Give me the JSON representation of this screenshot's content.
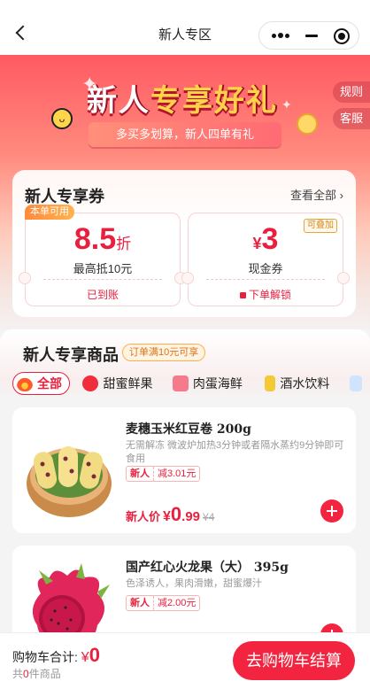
{
  "nav": {
    "title": "新人专区"
  },
  "banner": {
    "title_a": "新人",
    "title_b": "专享好礼",
    "subtitle": "多买多划算，新人四单有礼",
    "rules": "规则",
    "service": "客服"
  },
  "coupons": {
    "heading": "新人专享券",
    "view_all": "查看全部 ›",
    "items": [
      {
        "tag": "本单可用",
        "value": "8.5",
        "unit": "折",
        "desc": "最高抵10元",
        "status": "已到账"
      },
      {
        "tag": "可叠加",
        "currency": "¥",
        "value": "3",
        "desc": "现金券",
        "status": "下单解锁"
      }
    ]
  },
  "goods": {
    "heading": "新人专享商品",
    "tip": "订单满10元可享",
    "categories": [
      "全部",
      "甜蜜鲜果",
      "肉蛋海鲜",
      "酒水饮料"
    ],
    "products": [
      {
        "name": "麦穗玉米红豆卷 200g",
        "desc": "无需解冻 微波炉加热3分钟或者隔水蒸约9分钟即可食用",
        "badge_a": "新人",
        "badge_b": "减3.01元",
        "price_label": "新人价",
        "price_cur": "¥",
        "price_int": "0",
        "price_dec": ".99",
        "price_orig": "¥4"
      },
      {
        "name": "国产红心火龙果（大） 395g",
        "desc": "色泽诱人，果肉滑嫩，甜蜜爆汁",
        "badge_a": "新人",
        "badge_b": "减2.00元"
      }
    ]
  },
  "cart": {
    "total_label": "购物车合计:",
    "currency": "¥",
    "total": "0",
    "count_pre": "共",
    "count": "0",
    "count_post": "件商品",
    "checkout": "去购物车结算"
  },
  "colors": {
    "accent": "#f2243f",
    "banner_top": "#ff5a63",
    "tag_orange": "#ff8a3c"
  }
}
